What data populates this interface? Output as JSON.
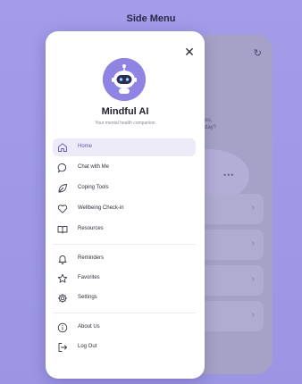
{
  "page_title": "Side Menu",
  "app": {
    "name": "Mindful AI",
    "tagline": "Your mental health companion",
    "background_text_line1": "ou,",
    "background_text_line2": "day?",
    "background_dots": "•••"
  },
  "menu_primary": [
    {
      "label": "Home",
      "icon": "home-icon",
      "active": true
    },
    {
      "label": "Chat with Me",
      "icon": "chat-bubble-icon",
      "active": false
    },
    {
      "label": "Coping Tools",
      "icon": "leaf-icon",
      "active": false
    },
    {
      "label": "Wellbeing Check-in",
      "icon": "heart-icon",
      "active": false
    },
    {
      "label": "Resources",
      "icon": "book-icon",
      "active": false
    }
  ],
  "menu_secondary": [
    {
      "label": "Reminders",
      "icon": "bell-icon"
    },
    {
      "label": "Favorites",
      "icon": "star-icon"
    },
    {
      "label": "Settings",
      "icon": "gear-icon"
    }
  ],
  "menu_tertiary": [
    {
      "label": "About Us",
      "icon": "info-icon"
    },
    {
      "label": "Log Out",
      "icon": "logout-icon"
    }
  ],
  "colors": {
    "background": "#9e98e6",
    "accent": "#8f84e4",
    "active_item_bg": "#ecebf7",
    "active_item_text": "#5d56b8"
  }
}
